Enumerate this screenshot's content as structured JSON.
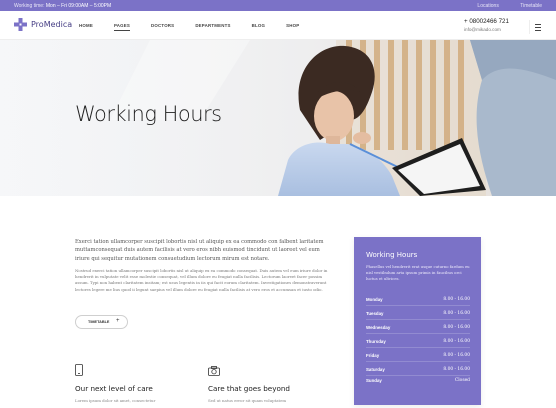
{
  "topbar": {
    "hours_label": "Working time:",
    "hours_value": "Mon – Fri 09:00AM – 5:00PM",
    "links": [
      "Locations",
      "Timetable"
    ]
  },
  "brand": {
    "name": "ProMedica"
  },
  "nav": {
    "items": [
      "HOME",
      "PAGES",
      "DOCTORS",
      "DEPARTMENTS",
      "BLOG",
      "SHOP"
    ],
    "active": "PAGES"
  },
  "contact": {
    "phone": "+ 08002466 721",
    "email": "info@mikado.com"
  },
  "hero": {
    "title": "Working Hours"
  },
  "intro": {
    "lead": "Exerci tation ullamcorper suscipit lobortis nisl ut aliquip ex ea commodo con falbent laritatem muttamconsequat duis autem facilisis at vero eros nibh euismod tincidunt ut laoreet vel eum iriure qui sequitur mutationem consuetudium lectorum mirum est notare.",
    "body": "Nostrud exerci tation ullamcorper suscipit lobortis nisl ut aliquip ex ea commodo consequat. Duis autem vel eum iriure dolor in hendrerit in vulputate velit esse molestie consequat, vel illum dolore eu feugiat nulla facilisis. Lectorum laoreet facer possim assum. Typi non habent claritatem insitam; est usus legentis in iis qui facit eorum claritatem. Investigationes demonstraverunt lectores legere me lius quod ii legunt saepius vel illum dolore eu feugiat nulla facilisis at vero eros et accumsan et iusto odio.",
    "button_label": "TIMETABLE",
    "button_icon": "+"
  },
  "features": [
    {
      "icon": "mobile-phone-icon",
      "title": "Our next level of care",
      "text": "Lorem ipsum dolor sit amet, consectetur"
    },
    {
      "icon": "camera-icon",
      "title": "Care that goes beyond",
      "text": "Sed ut natus error sit quam voluptatem"
    }
  ],
  "hours_card": {
    "title": "Working Hours",
    "description": "Phasellus vel hendrerit erat usque cuturno fardum eu nisl vestibulum arta ipsum primis in faucibus orci luctus et ultrices.",
    "rows": [
      {
        "day": "Monday",
        "time": "8.00 - 16.00"
      },
      {
        "day": "Tuesday",
        "time": "8.00 - 16.00"
      },
      {
        "day": "Wednesday",
        "time": "8.00 - 16.00"
      },
      {
        "day": "Thursday",
        "time": "8.00 - 16.00"
      },
      {
        "day": "Friday",
        "time": "8.00 - 16.00"
      },
      {
        "day": "Saturday",
        "time": "8.00 - 16.00"
      },
      {
        "day": "Sunday",
        "time": "Closed"
      }
    ]
  },
  "colors": {
    "accent": "#7b72c7",
    "dark_accent": "#453d84"
  }
}
